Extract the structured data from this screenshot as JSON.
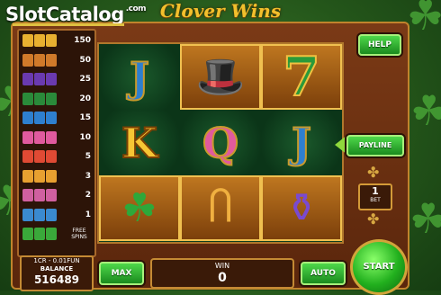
{
  "watermark": {
    "brand": "SlotCatalog",
    "suffix": ".com"
  },
  "game": {
    "title": "Clover Wins"
  },
  "paytable": {
    "rows": [
      {
        "symbol": "sevens-icon",
        "value": "150",
        "colors": [
          "#e8b030",
          "#e8b030",
          "#e8b030"
        ]
      },
      {
        "symbol": "horseshoe-icon",
        "value": "50",
        "colors": [
          "#d07a2a",
          "#d07a2a",
          "#d07a2a"
        ]
      },
      {
        "symbol": "pot-of-gold-icon",
        "value": "25",
        "colors": [
          "#6a3ab0",
          "#6a3ab0",
          "#6a3ab0"
        ]
      },
      {
        "symbol": "leprechaun-hat-icon",
        "value": "20",
        "colors": [
          "#2a8a3a",
          "#2a8a3a",
          "#2a8a3a"
        ]
      },
      {
        "symbol": "letter-j-icon",
        "value": "15",
        "colors": [
          "#2e7fcf",
          "#2e7fcf",
          "#2e7fcf"
        ]
      },
      {
        "symbol": "letter-q-icon",
        "value": "10",
        "colors": [
          "#e05a9e",
          "#e05a9e",
          "#e05a9e"
        ]
      },
      {
        "symbol": "letter-a-icon",
        "value": "5",
        "colors": [
          "#e04a34",
          "#e04a34",
          "#e04a34"
        ]
      },
      {
        "symbol": "letter-k-icon",
        "value": "3",
        "colors": [
          "#e8a030",
          "#e8a030",
          "#e8a030"
        ]
      },
      {
        "symbol": "letter-q-small-icon",
        "value": "2",
        "colors": [
          "#d060a0",
          "#d060a0",
          "#d060a0"
        ]
      },
      {
        "symbol": "letter-j-small-icon",
        "value": "1",
        "colors": [
          "#3a8ad0",
          "#3a8ad0",
          "#3a8ad0"
        ]
      },
      {
        "symbol": "clover-scatter-icon",
        "value": "FREE SPINS",
        "colors": [
          "#3aa83a",
          "#3aa83a",
          "#3aa83a"
        ]
      }
    ]
  },
  "reels": {
    "symbols": [
      {
        "name": "letter-j-icon",
        "type": "letter",
        "glyph": "J",
        "style": "blue",
        "bg": "dark"
      },
      {
        "name": "leprechaun-hat-icon",
        "type": "glyph",
        "glyph": "🎩",
        "style": "",
        "bg": "box"
      },
      {
        "name": "lucky-seven-icon",
        "type": "seven",
        "glyph": "7",
        "style": "",
        "bg": "box"
      },
      {
        "name": "letter-k-icon",
        "type": "letter",
        "glyph": "K",
        "style": "",
        "bg": "dark"
      },
      {
        "name": "letter-q-icon",
        "type": "letter",
        "glyph": "Q",
        "style": "pink",
        "bg": "dark"
      },
      {
        "name": "letter-j-icon",
        "type": "letter",
        "glyph": "J",
        "style": "blue",
        "bg": "dark"
      },
      {
        "name": "four-leaf-clover-icon",
        "type": "glyph",
        "glyph": "☘",
        "style": "",
        "bg": "box"
      },
      {
        "name": "horseshoe-icon",
        "type": "glyph",
        "glyph": "Ⴖ",
        "style": "",
        "bg": "box"
      },
      {
        "name": "pot-of-gold-icon",
        "type": "glyph",
        "glyph": "⚱",
        "style": "",
        "bg": "box"
      }
    ]
  },
  "controls": {
    "help": "HELP",
    "payline": "PAYLINE",
    "bet_value": "1",
    "bet_label": "BET",
    "coin_info": "1CR - 0.01FUN",
    "balance_label": "BALANCE",
    "balance_value": "516489",
    "max": "MAX",
    "win_label": "WIN",
    "win_value": "0",
    "auto": "AUTO",
    "start": "START"
  }
}
